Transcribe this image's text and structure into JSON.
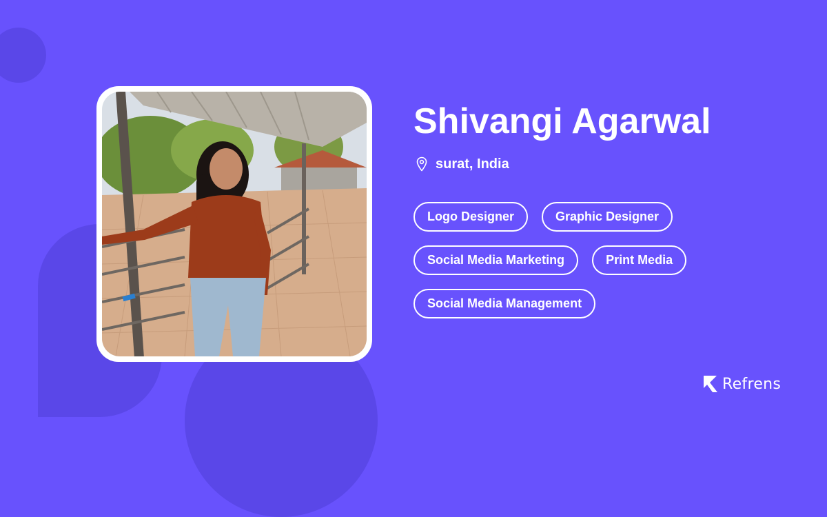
{
  "profile": {
    "name": "Shivangi Agarwal",
    "location": "surat, India",
    "pin_icon": "location-pin-icon",
    "photo_alt": "Profile photo of Shivangi Agarwal",
    "skills": [
      "Logo Designer",
      "Graphic Designer",
      "Social Media Marketing",
      "Print Media",
      "Social Media Management"
    ]
  },
  "brand": {
    "name": "Refrens",
    "icon": "refrens-logo-icon"
  },
  "colors": {
    "background": "#6852fd",
    "accent_shape": "#5a47e8",
    "text": "#ffffff"
  }
}
